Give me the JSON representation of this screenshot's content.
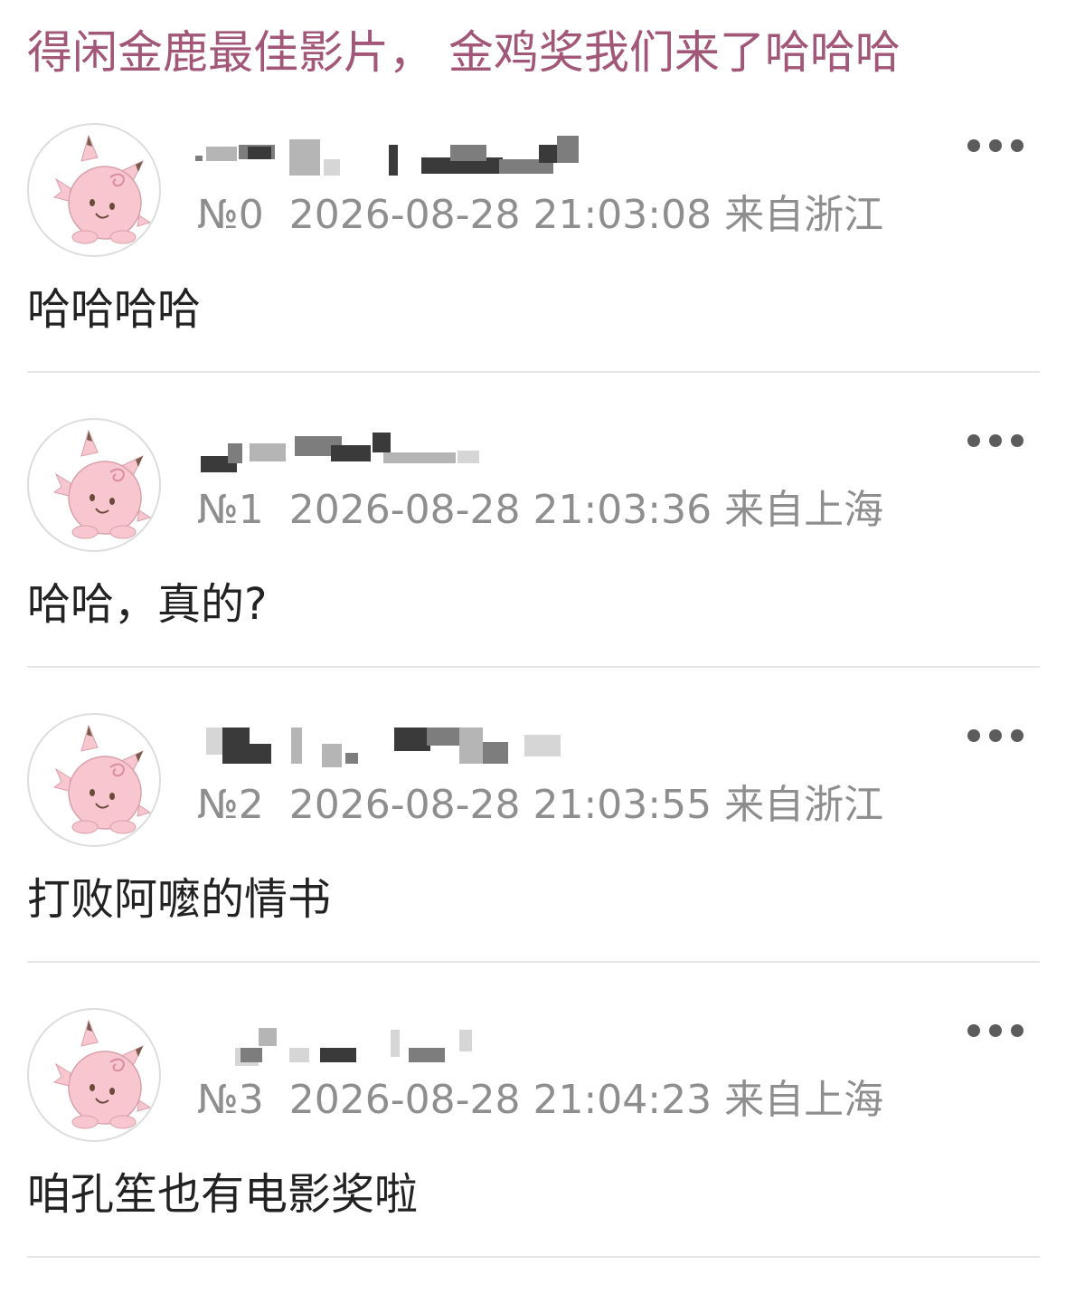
{
  "post": {
    "title": "得闲金鹿最佳影片， 金鸡奖我们来了哈哈哈"
  },
  "comments": [
    {
      "floor": "№0",
      "time": "2026-08-28 21:03:08",
      "location": "来自浙江",
      "text": "哈哈哈哈",
      "avatar_icon": "pink-creature-avatar-icon",
      "more_icon": "more-dots-icon"
    },
    {
      "floor": "№1",
      "time": "2026-08-28 21:03:36",
      "location": "来自上海",
      "text": "哈哈，真的?",
      "avatar_icon": "pink-creature-avatar-icon",
      "more_icon": "more-dots-icon"
    },
    {
      "floor": "№2",
      "time": "2026-08-28 21:03:55",
      "location": "来自浙江",
      "text": "打败阿嚒的情书",
      "avatar_icon": "pink-creature-avatar-icon",
      "more_icon": "more-dots-icon"
    },
    {
      "floor": "№3",
      "time": "2026-08-28 21:04:23",
      "location": "来自上海",
      "text": "咱孔笙也有电影奖啦",
      "avatar_icon": "pink-creature-avatar-icon",
      "more_icon": "more-dots-icon"
    }
  ],
  "colors": {
    "title": "#a25778",
    "meta": "#8e8e8e",
    "text": "#222222",
    "divider": "#e6e6e6",
    "avatar_body": "#f7c6cf"
  }
}
